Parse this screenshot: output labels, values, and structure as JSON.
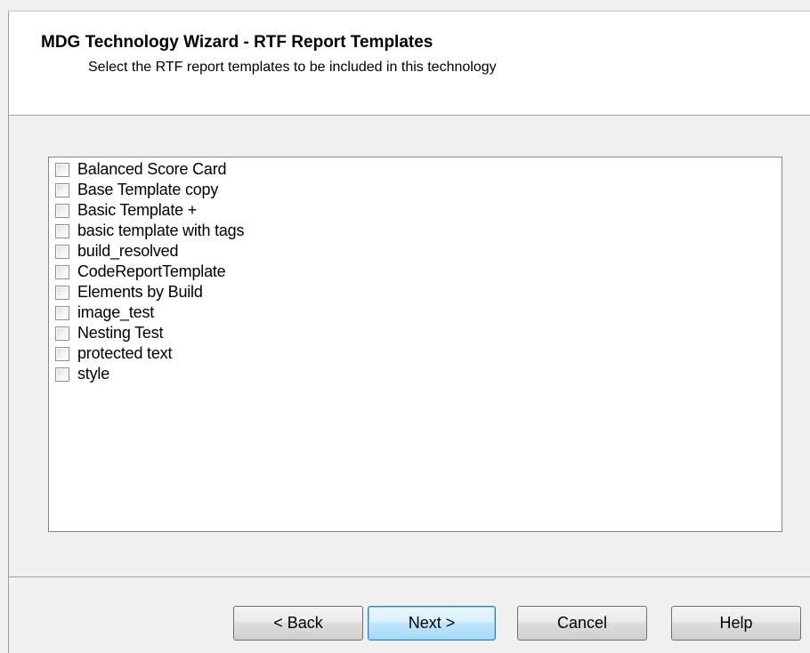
{
  "header": {
    "title": "MDG Technology Wizard - RTF Report Templates",
    "subtitle": "Select the RTF report templates to be included in this technology"
  },
  "templates": [
    {
      "label": "Balanced Score Card",
      "checked": false
    },
    {
      "label": "Base Template copy",
      "checked": false
    },
    {
      "label": "Basic Template +",
      "checked": false
    },
    {
      "label": "basic template with tags",
      "checked": false
    },
    {
      "label": "build_resolved",
      "checked": false
    },
    {
      "label": "CodeReportTemplate",
      "checked": false
    },
    {
      "label": "Elements by Build",
      "checked": false
    },
    {
      "label": "image_test",
      "checked": false
    },
    {
      "label": "Nesting Test",
      "checked": false
    },
    {
      "label": "protected text",
      "checked": false
    },
    {
      "label": "style",
      "checked": false
    }
  ],
  "buttons": {
    "back": "< Back",
    "next": "Next >",
    "cancel": "Cancel",
    "help": "Help"
  },
  "colors": {
    "dialog_background": "#f0f0f0",
    "header_background": "#ffffff",
    "list_background": "#ffffff",
    "default_button_border": "#3c7fb1"
  }
}
